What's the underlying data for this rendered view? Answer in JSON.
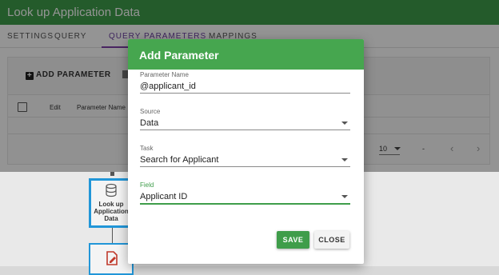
{
  "app": {
    "title": "Look up Application Data"
  },
  "tabs": [
    {
      "label": "SETTINGS"
    },
    {
      "label": "QUERY"
    },
    {
      "label": "QUERY PARAMETERS"
    },
    {
      "label": "MAPPINGS"
    }
  ],
  "toolbar": {
    "add_parameter_label": "ADD PARAMETER"
  },
  "table": {
    "headers": {
      "edit": "Edit",
      "parameter_name": "Parameter Name"
    }
  },
  "pager": {
    "rows_per_page": "10",
    "range": "-",
    "prev_icon": "chevron-left-icon",
    "next_icon": "chevron-right-icon"
  },
  "flow": {
    "node_label": "Look up Application Data",
    "node_icon": "database-icon",
    "next_node_icon": "edit-document-icon"
  },
  "dialog": {
    "title": "Add Parameter",
    "fields": {
      "parameter_name": {
        "label": "Parameter Name",
        "value": "@applicant_id"
      },
      "source": {
        "label": "Source",
        "value": "Data"
      },
      "task": {
        "label": "Task",
        "value": "Search for Applicant"
      },
      "field": {
        "label": "Field",
        "value": "Applicant ID"
      }
    },
    "save_label": "SAVE",
    "close_label": "CLOSE"
  },
  "colors": {
    "brand_green": "#3f9d4a",
    "tab_accent": "#7e3fa8",
    "node_border": "#2196d8"
  }
}
